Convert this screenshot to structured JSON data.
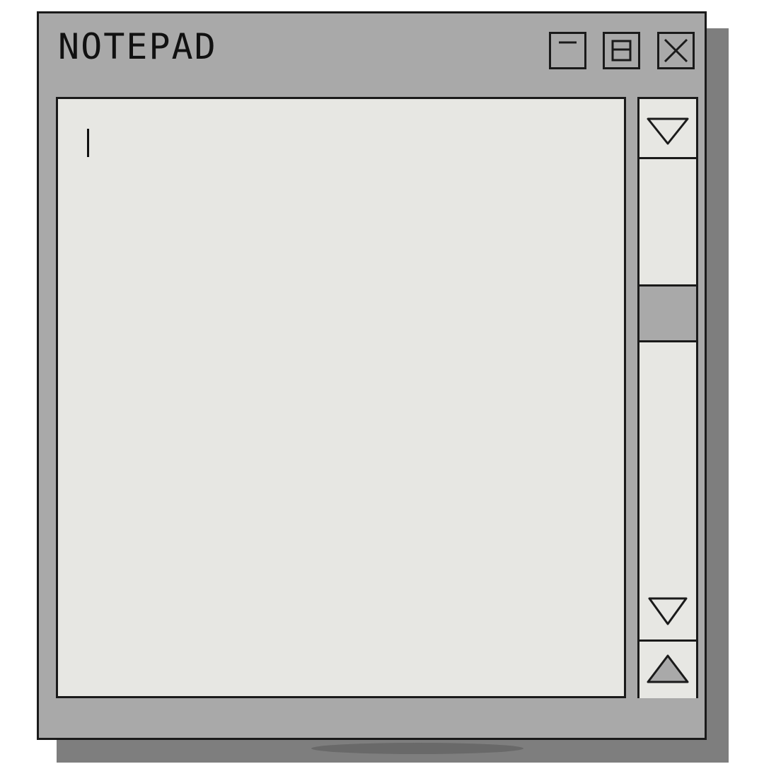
{
  "window": {
    "title": "NOTEPAD",
    "controls": {
      "minimize_icon": "minimize-icon",
      "maximize_icon": "restore-icon",
      "close_icon": "close-icon"
    }
  },
  "editor": {
    "content": ""
  },
  "scrollbar": {
    "up_icon": "triangle-down-icon",
    "down_icon": "triangle-up-icon",
    "position": 0.3
  },
  "colors": {
    "chrome": "#a9a9a9",
    "shadow": "#7e7e7e",
    "content": "#e7e7e3",
    "border": "#1a1a1a"
  }
}
